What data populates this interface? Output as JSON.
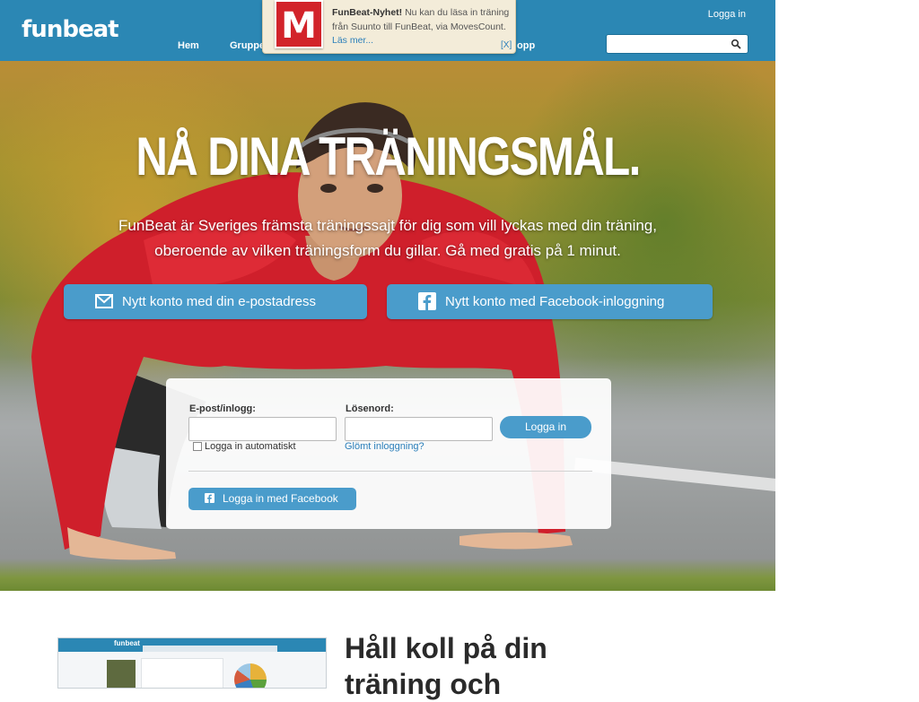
{
  "header": {
    "logo": "funbeat",
    "nav": [
      "Hem",
      "Grupper",
      "opp"
    ],
    "login": "Logga in",
    "search_placeholder": ""
  },
  "notification": {
    "logo_letter": "M",
    "title": "FunBeat-Nyhet!",
    "body": "Nu kan du läsa in träning från Suunto till FunBeat, via MovesCount.",
    "more": "Läs mer...",
    "close": "[X]"
  },
  "hero": {
    "title": "NÅ DINA TRÄNINGSMÅL.",
    "subtitle": "FunBeat är Sveriges främsta träningssajt för dig som vill lyckas med din träning, oberoende av vilken träningsform du gillar. Gå med gratis på 1 minut.",
    "cta_email": "Nytt konto med din e-postadress",
    "cta_facebook": "Nytt konto med Facebook-inloggning"
  },
  "login": {
    "email_label": "E-post/inlogg:",
    "email_value": "",
    "password_label": "Lösenord:",
    "password_value": "",
    "remember_label": "Logga in automatiskt",
    "remember_checked": false,
    "forgot": "Glömt inloggning?",
    "submit": "Logga in",
    "facebook": "Logga in med Facebook"
  },
  "lower": {
    "preview_logo": "funbeat",
    "title": "Håll koll på din träning och"
  },
  "colors": {
    "header_bg": "#2b87b4",
    "button_bg": "#4a9ccb",
    "notif_bg": "#f3ecd9",
    "notif_logo": "#d2232a"
  }
}
